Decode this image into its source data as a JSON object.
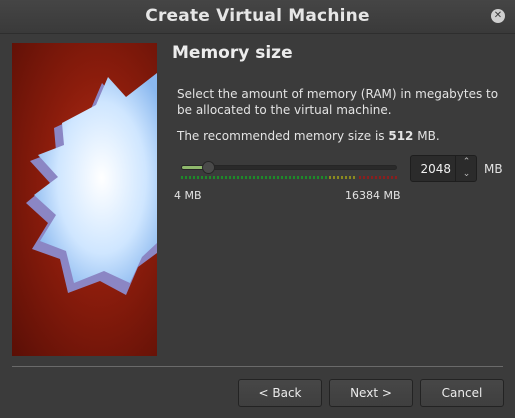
{
  "window": {
    "title": "Create Virtual Machine"
  },
  "section": {
    "title": "Memory size"
  },
  "description": "Select the amount of memory (RAM) in megabytes to be allocated to the virtual machine.",
  "recommendation": {
    "prefix": "The recommended memory size is ",
    "value": "512",
    "suffix": " MB."
  },
  "slider": {
    "min_label": "4 MB",
    "max_label": "16384 MB",
    "min": 4,
    "max": 16384,
    "value": 2048
  },
  "spinbox": {
    "value": "2048",
    "unit": "MB"
  },
  "buttons": {
    "back": "< Back",
    "next": "Next >",
    "cancel": "Cancel"
  },
  "icons": {
    "close": "close-icon",
    "spin_up": "chevron-up-icon",
    "spin_down": "chevron-down-icon"
  },
  "colors": {
    "slider_fill": "#8fb86c",
    "image_bg": "#8a1c0c"
  }
}
